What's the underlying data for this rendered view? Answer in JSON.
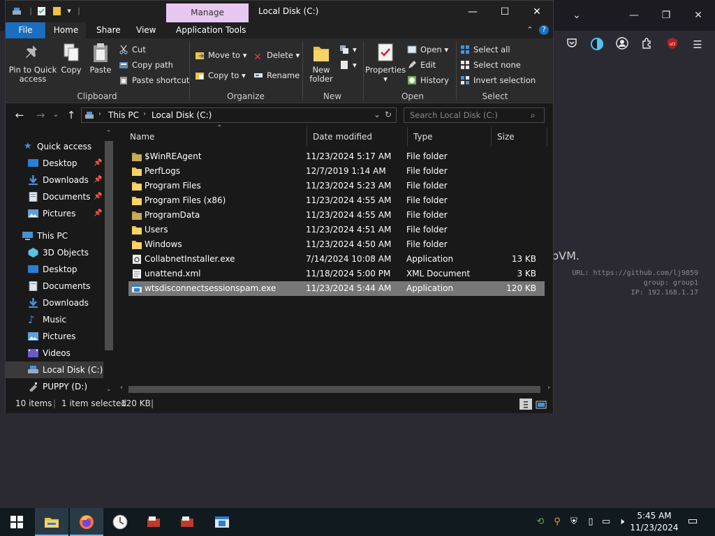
{
  "browser": {
    "partial_text": "bVM.",
    "meta_lines": [
      "URL: https://github.com/lj9859",
      "group: group1",
      "IP: 192.168.1.17"
    ]
  },
  "window": {
    "manage_tab": "Manage",
    "title": "Local Disk (C:)"
  },
  "ribbon_tabs": {
    "file": "File",
    "home": "Home",
    "share": "Share",
    "view": "View",
    "app_tools": "Application Tools"
  },
  "ribbon": {
    "pin_to_quick_access": "Pin to Quick access",
    "copy": "Copy",
    "paste": "Paste",
    "cut": "Cut",
    "copy_path": "Copy path",
    "paste_shortcut": "Paste shortcut",
    "clipboard_group": "Clipboard",
    "move_to": "Move to",
    "copy_to": "Copy to",
    "delete": "Delete",
    "rename": "Rename",
    "organize_group": "Organize",
    "new_folder": "New folder",
    "new_group": "New",
    "properties": "Properties",
    "open": "Open",
    "edit": "Edit",
    "history": "History",
    "open_group": "Open",
    "select_all": "Select all",
    "select_none": "Select none",
    "invert_selection": "Invert selection",
    "select_group": "Select"
  },
  "address": {
    "crumbs": [
      "This PC",
      "Local Disk (C:)"
    ],
    "search_placeholder": "Search Local Disk (C:)"
  },
  "nav": {
    "quick_access": "Quick access",
    "quick_items": [
      "Desktop",
      "Downloads",
      "Documents",
      "Pictures"
    ],
    "this_pc": "This PC",
    "pc_items": [
      "3D Objects",
      "Desktop",
      "Documents",
      "Downloads",
      "Music",
      "Pictures",
      "Videos",
      "Local Disk (C:)",
      "PUPPY (D:)"
    ]
  },
  "columns": {
    "name": "Name",
    "date": "Date modified",
    "type": "Type",
    "size": "Size"
  },
  "files": [
    {
      "name": "$WinREAgent",
      "date": "11/23/2024 5:17 AM",
      "type": "File folder",
      "size": "",
      "kind": "folder-dim"
    },
    {
      "name": "PerfLogs",
      "date": "12/7/2019 1:14 AM",
      "type": "File folder",
      "size": "",
      "kind": "folder"
    },
    {
      "name": "Program Files",
      "date": "11/23/2024 5:23 AM",
      "type": "File folder",
      "size": "",
      "kind": "folder"
    },
    {
      "name": "Program Files (x86)",
      "date": "11/23/2024 4:55 AM",
      "type": "File folder",
      "size": "",
      "kind": "folder"
    },
    {
      "name": "ProgramData",
      "date": "11/23/2024 4:55 AM",
      "type": "File folder",
      "size": "",
      "kind": "folder-dim"
    },
    {
      "name": "Users",
      "date": "11/23/2024 4:51 AM",
      "type": "File folder",
      "size": "",
      "kind": "folder"
    },
    {
      "name": "Windows",
      "date": "11/23/2024 4:50 AM",
      "type": "File folder",
      "size": "",
      "kind": "folder"
    },
    {
      "name": "CollabnetInstaller.exe",
      "date": "7/14/2024 10:08 AM",
      "type": "Application",
      "size": "13 KB",
      "kind": "exe-gear"
    },
    {
      "name": "unattend.xml",
      "date": "11/18/2024 5:00 PM",
      "type": "XML Document",
      "size": "3 KB",
      "kind": "xml"
    },
    {
      "name": "wtsdisconnectsessionspam.exe",
      "date": "11/23/2024 5:44 AM",
      "type": "Application",
      "size": "120 KB",
      "kind": "exe",
      "selected": true
    }
  ],
  "status": {
    "count": "10 items",
    "selected": "1 item selected",
    "size": "120 KB"
  },
  "taskbar": {
    "time": "5:45 AM",
    "date": "11/23/2024"
  },
  "colors": {
    "accent": "#1a6ec0",
    "manage_tab": "#e8c8f0",
    "folder": "#f0c24a",
    "selection": "#777777"
  }
}
